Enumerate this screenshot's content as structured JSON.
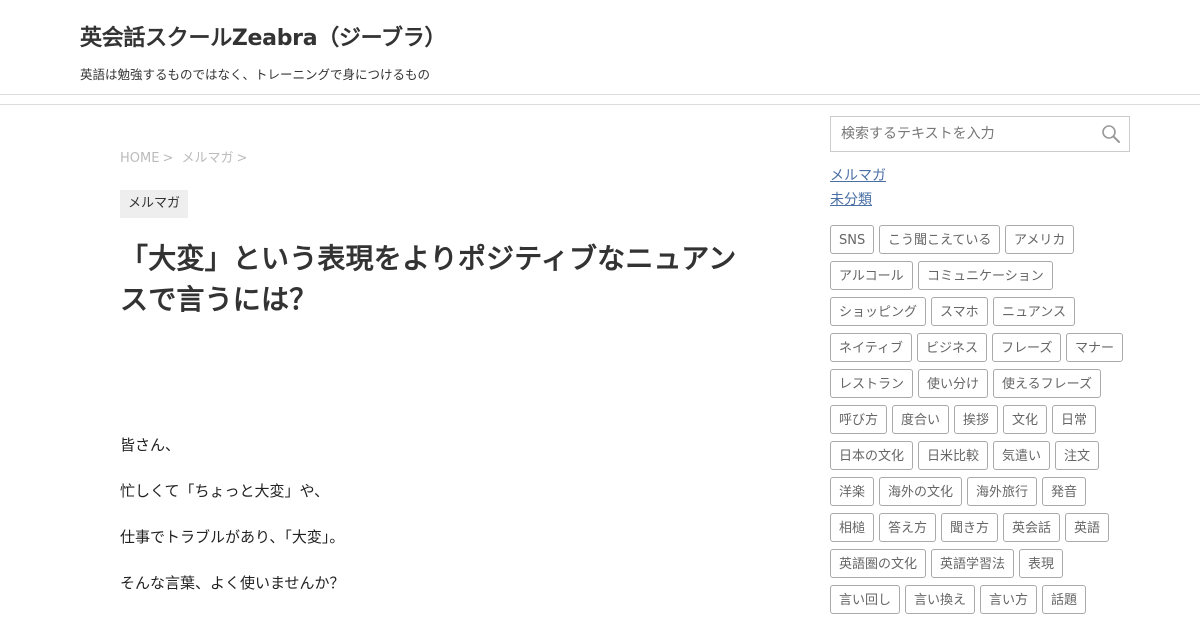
{
  "header": {
    "site_title": "英会話スクールZeabra（ジーブラ）",
    "tagline": "英語は勉強するものではなく、トレーニングで身につけるもの"
  },
  "breadcrumb": {
    "home": "HOME",
    "category": "メルマガ",
    "separator": ">"
  },
  "post": {
    "category": "メルマガ",
    "title": "「大変」という表現をよりポジティブなニュアンスで言うには？",
    "paragraphs": [
      "皆さん、",
      "忙しくて「ちょっと大変」や、",
      "仕事でトラブルがあり、「大変」。",
      "そんな言葉、よく使いませんか？"
    ]
  },
  "sidebar": {
    "search_placeholder": "検索するテキストを入力",
    "search_icon": "search-icon",
    "categories": [
      "メルマガ",
      "未分類"
    ],
    "tags": [
      [
        "SNS",
        "こう聞こえている",
        "アメリカ"
      ],
      [
        "アルコール",
        "コミュニケーション"
      ],
      [
        "ショッピング",
        "スマホ",
        "ニュアンス"
      ],
      [
        "ネイティブ",
        "ビジネス",
        "フレーズ",
        "マナー"
      ],
      [
        "レストラン",
        "使い分け",
        "使えるフレーズ"
      ],
      [
        "呼び方",
        "度合い",
        "挨拶",
        "文化",
        "日常"
      ],
      [
        "日本の文化",
        "日米比較",
        "気遣い",
        "注文"
      ],
      [
        "洋楽",
        "海外の文化",
        "海外旅行",
        "発音"
      ],
      [
        "相槌",
        "答え方",
        "聞き方",
        "英会話",
        "英語"
      ],
      [
        "英語圏の文化",
        "英語学習法",
        "表現"
      ],
      [
        "言い回し",
        "言い換え",
        "言い方",
        "話題"
      ]
    ]
  },
  "colors": {
    "link": "#4a6fa5",
    "text": "#333333",
    "border": "#dddddd",
    "tag_border": "#aaaaaa"
  }
}
